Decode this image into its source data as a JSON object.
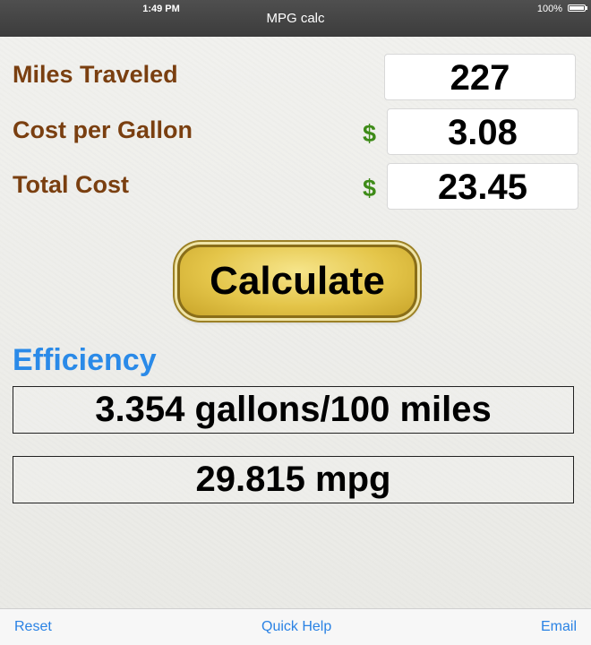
{
  "status_bar": {
    "time": "1:49 PM",
    "battery": "100%"
  },
  "app_title": "MPG calc",
  "inputs": {
    "miles": {
      "label": "Miles Traveled",
      "value": "227"
    },
    "cost_per_gallon": {
      "label": "Cost per Gallon",
      "currency": "$",
      "value": "3.08"
    },
    "total_cost": {
      "label": "Total Cost",
      "currency": "$",
      "value": "23.45"
    }
  },
  "calculate_label": "Calculate",
  "efficiency": {
    "title": "Efficiency",
    "gallons_per_100": "3.354 gallons/100 miles",
    "mpg": "29.815 mpg"
  },
  "toolbar": {
    "reset": "Reset",
    "quick_help": "Quick Help",
    "email": "Email"
  },
  "colors": {
    "label_brown": "#7a3f10",
    "currency_green": "#3e8b18",
    "efficiency_blue": "#2a8ae8",
    "toolbar_link": "#2a82e4",
    "button_gold": "#e4c549"
  }
}
